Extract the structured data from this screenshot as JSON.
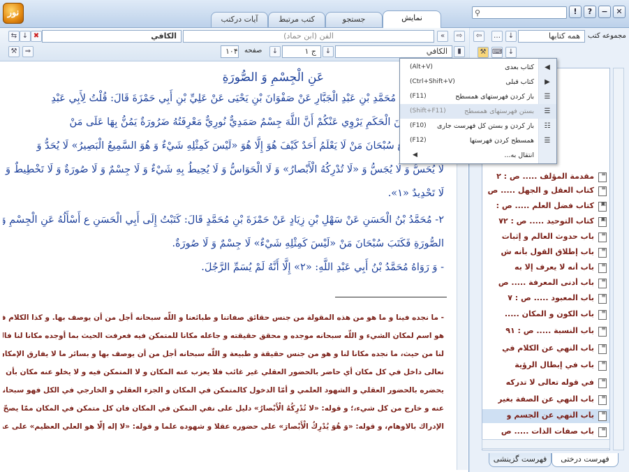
{
  "app": {
    "logo_text": "نور"
  },
  "top_tabs": [
    {
      "label": "نمایش",
      "active": true
    },
    {
      "label": "جستجو",
      "active": false
    },
    {
      "label": "کتب مرتبط",
      "active": false
    },
    {
      "label": "آیات درکتب",
      "active": false
    }
  ],
  "window_buttons": {
    "close": "✕",
    "help": "?",
    "info": "!",
    "minimize": "−"
  },
  "search": {
    "value": "",
    "icon": "search-icon"
  },
  "reader": {
    "book_title": "الكافي",
    "section_field": "الفن (ابن حماد)",
    "book_field": "الكافي",
    "volume_label": "ج ۱",
    "page_label": "صفحه",
    "page_value": "۱۰۴",
    "heading": "عَنِ الْجِسْمِ وَ الصُّورَةِ",
    "lines": [
      "إِدْرِيسَ عَنْ مُحَمَّدِ بْنِ عَبْدِ الْجَبَّارِ عَنْ صَفْوَانَ بْنِ يَحْيَى عَنْ عَلِيِّ بْنِ أَبِي حَمْزَةَ قَالَ: قُلْتُ لِأَبِي عَبْدِ",
      "تُ هِشَامَ بْنَ الْحَكَمِ يَرْوِي عَنْكُمْ أَنَّ اللَّهَ جِسْمٌ صَمَدِيٌّ نُورِيٌّ مَعْرِفَتُهُ ضَرُورَةٌ يَمُنُّ بِهَا عَلَى مَنْ",
      "لْقِهِ فَقَالَ ع سُبْحَانَ مَنْ لَا يَعْلَمُ أَحَدٌ كَيْفَ هُوَ إِلَّا هُوَ «لَيْسَ كَمِثْلِهِ شَيْءٌ وَ هُوَ السَّمِيعُ الْبَصِيرُ» لَا يُحَدُّ وَ",
      "لَا يُحَسُّ وَ لَا يُجَسُّ وَ «لَا تُدْرِكُهُ الْأَبْصارُ» وَ لَا الْحَوَاسُّ وَ لَا يُحِيطُ بِهِ شَيْءٌ وَ لَا جِسْمٌ وَ لَا صُورَةٌ وَ لَا تَخْطِيطٌ وَ",
      "لَا تَحْدِيدٌ «۱».",
      "۲- مُحَمَّدُ بْنُ الْحَسَنِ عَنْ سَهْلِ بْنِ زِيَادٍ عَنْ حَمْزَةَ بْنِ مُحَمَّدٍ قَالَ: كَتَبْتُ إِلَى أَبِي الْحَسَنِ ع أَسْأَلُهُ عَنِ الْجِسْمِ وَ",
      "الصُّورَةِ فَكَتَبَ سُبْحَانَ مَنْ «لَيْسَ كَمِثْلِهِ شَيْءٌ» لَا جِسْمٌ وَ لَا صُورَةٌ.",
      "- وَ رَوَاهُ مُحَمَّدُ بْنُ أَبِي عَبْدِ اللَّهِ: «۲» إِلَّا أَنَّهُ لَمْ يُسَمِّ الرَّجُلَ."
    ],
    "commentary": [
      "- ما نجده فينا و ما هو من هذه المقولة من جنس حقائق صفاتنا و طبائعنا و اللّه سبحانه أجل من أن يوصف بها. و كذا الكلام في حيث و",
      "هو اسم لمكان الشيء و اللّه سبحانه موجده و محقق حقيقته و جاعله مكانا للمتمكن فيه فعرفت الحيث بما أوجده مكانا لنا فالمعلوم",
      "لنا من حيث، ما نجده مكانا لنا و هو من جنس حقيقة و طبيعة و اللّه سبحانه أجل من أن يوصف بها و بسائر ما لا يفارق الإمكان فاللّه",
      "تعالى داخل في كل مكان أي حاضر بالحضور العقلي غير غائب فلا يعزب عنه المكان و لا المتمكن فيه و لا يخلو عنه مكان بأن لا",
      "يحضره بالحضور العقلي و الشهود العلمي و أمّا الدخول كالمتمكن في المكان و الجزء العقلي و الخارجي في الكل فهو سبحانه منزه",
      "عنه و خارج من كل شيء،؛ و قوله: «لا تُدْرِكُهُ الْأَبْصارُ» دليل على نفي التمكن في المكان فان كل متمكن في المكان ممّا يصحّ عليه",
      "الإدراك بالاوهام، و قوله: «وَ هُوَ يُدْرِكُ الْأَبْصارَ» على حضوره عقلا و شهوده علما و قوله: «لا إله إلّا هو العلي العظيم» على عدم كونه"
    ]
  },
  "sidebar": {
    "collection_label": "مجموعه کتب",
    "collection_value": "همه کتابها",
    "tree_items": [
      {
        "label": "مقدمة المؤلف ..... ص : ۲",
        "selected": false
      },
      {
        "label": "كتاب العقل و الجهل ..... ص",
        "selected": false
      },
      {
        "label": "كتاب فضل العلم ..... ص :",
        "selected": false
      },
      {
        "label": "كتاب التوحيد ..... ص : ۷۲",
        "selected": false
      },
      {
        "label": "باب حدوث العالم و إثبات",
        "selected": false
      },
      {
        "label": "باب إطلاق القول بأنه ش",
        "selected": false
      },
      {
        "label": "باب أنه لا يعرف إلا به",
        "selected": false
      },
      {
        "label": "باب أدنى المعرفة ..... ص",
        "selected": false
      },
      {
        "label": "باب المعبود ..... ص : ۷",
        "selected": false
      },
      {
        "label": "باب الكون و المكان .....",
        "selected": false
      },
      {
        "label": "باب النسبة ..... ص : ۹۱",
        "selected": false
      },
      {
        "label": "باب النهي عن الكلام في",
        "selected": false
      },
      {
        "label": "باب في إبطال الرؤية",
        "selected": false
      },
      {
        "label": "في قوله تعالى لا تدركه",
        "selected": false
      },
      {
        "label": "باب النهي عن الصفة بغير",
        "selected": false
      },
      {
        "label": "باب النهي عن الجسم و",
        "selected": true
      },
      {
        "label": "باب صفات الذات ..... ص",
        "selected": false
      }
    ],
    "bottom_tabs": [
      {
        "label": "فهرست درختی",
        "active": true
      },
      {
        "label": "فهرست گزینشی",
        "active": false
      }
    ]
  },
  "context_menu": {
    "items": [
      {
        "label": "کتاب بعدی",
        "shortcut": "(Alt+V)",
        "icon": "next-book-icon",
        "disabled": false
      },
      {
        "label": "کتاب قبلی",
        "shortcut": "(Ctrl+Shift+V)",
        "icon": "previous-book-icon",
        "disabled": false
      },
      {
        "label": "باز کردن فهرستهای همسطح",
        "shortcut": "(F11)",
        "icon": "expand-siblings-icon",
        "disabled": false
      },
      {
        "label": "بستن فهرستهای همسطح",
        "shortcut": "(Shift+F11)",
        "icon": "collapse-siblings-icon",
        "disabled": true
      },
      {
        "label": "باز کردن و بستن کل فهرست جاری",
        "shortcut": "(F10)",
        "icon": "toggle-all-icon",
        "disabled": false
      },
      {
        "label": "همسطح کردن فهرستها",
        "shortcut": "(F12)",
        "icon": "flatten-icon",
        "disabled": false
      },
      {
        "label": "انتقال به...",
        "shortcut": "",
        "icon": "",
        "disabled": false,
        "has_submenu": true
      }
    ]
  }
}
